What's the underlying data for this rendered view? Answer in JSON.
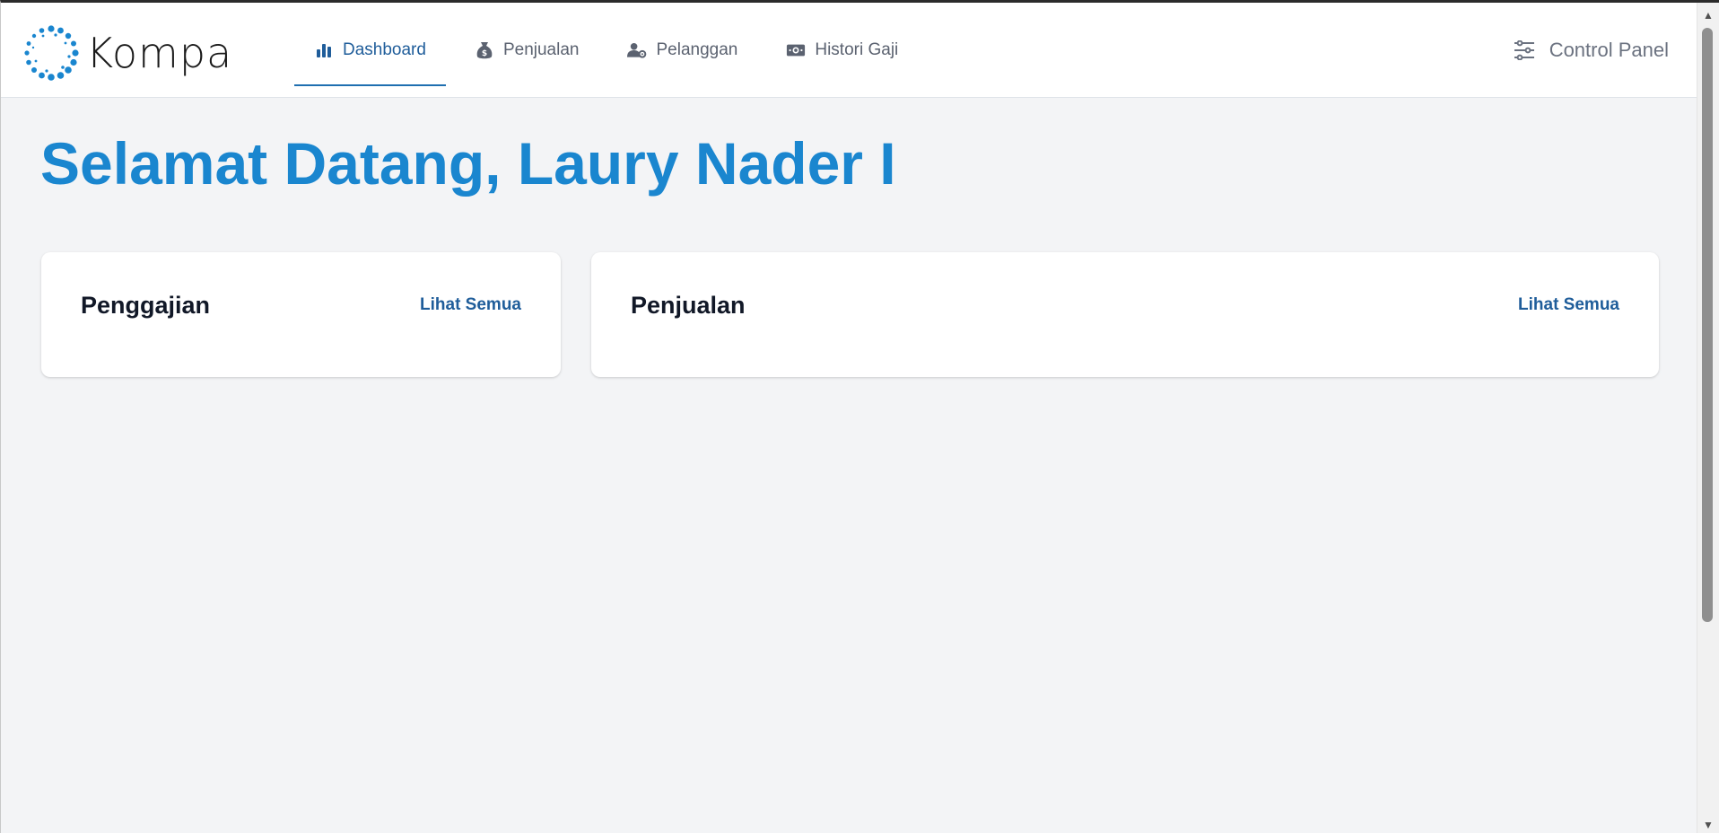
{
  "brand": {
    "name": "Kompa",
    "accent": "#1a86cf"
  },
  "nav": {
    "items": [
      {
        "label": "Dashboard",
        "icon": "bar-chart-icon",
        "active": true
      },
      {
        "label": "Penjualan",
        "icon": "money-bag-icon",
        "active": false
      },
      {
        "label": "Pelanggan",
        "icon": "user-gear-icon",
        "active": false
      },
      {
        "label": "Histori Gaji",
        "icon": "banknote-icon",
        "active": false
      }
    ]
  },
  "control_panel": {
    "label": "Control Panel",
    "icon": "sliders-icon"
  },
  "welcome": {
    "title": "Selamat Datang, Laury Nader I"
  },
  "cards": [
    {
      "title": "Penggajian",
      "link": "Lihat Semua"
    },
    {
      "title": "Penjualan",
      "link": "Lihat Semua"
    }
  ],
  "colors": {
    "heading": "#1a86cf",
    "link": "#1f5d9a",
    "background": "#f3f4f6"
  }
}
